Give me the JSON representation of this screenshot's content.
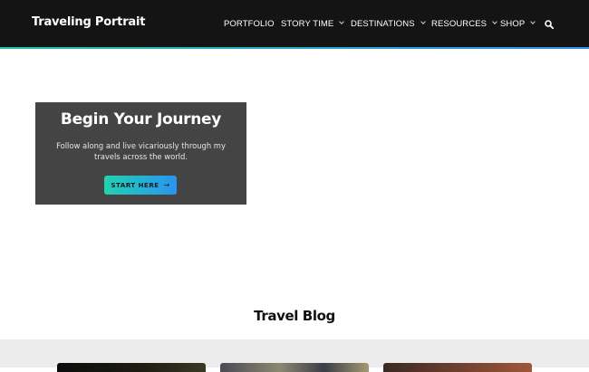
{
  "header": {
    "brand": "Traveling Portrait",
    "nav": [
      {
        "label": "PORTFOLIO",
        "has_dropdown": false
      },
      {
        "label": "STORY TIME",
        "has_dropdown": true
      },
      {
        "label": "DESTINATIONS",
        "has_dropdown": true
      },
      {
        "label": "RESOURCES",
        "has_dropdown": true
      },
      {
        "label": "SHOP",
        "has_dropdown": true
      }
    ],
    "search_icon": "search-icon"
  },
  "hero": {
    "title": "Begin Your Journey",
    "text": "Follow along and live vicariously through my travels across the world.",
    "cta_label": "START HERE",
    "cta_arrow": "→"
  },
  "blog": {
    "title": "Travel Blog"
  },
  "colors": {
    "header_bg": "#141414",
    "accent_start": "#19c3a8",
    "accent_end": "#2f8fe8",
    "hero_card_bg": "#444444"
  }
}
